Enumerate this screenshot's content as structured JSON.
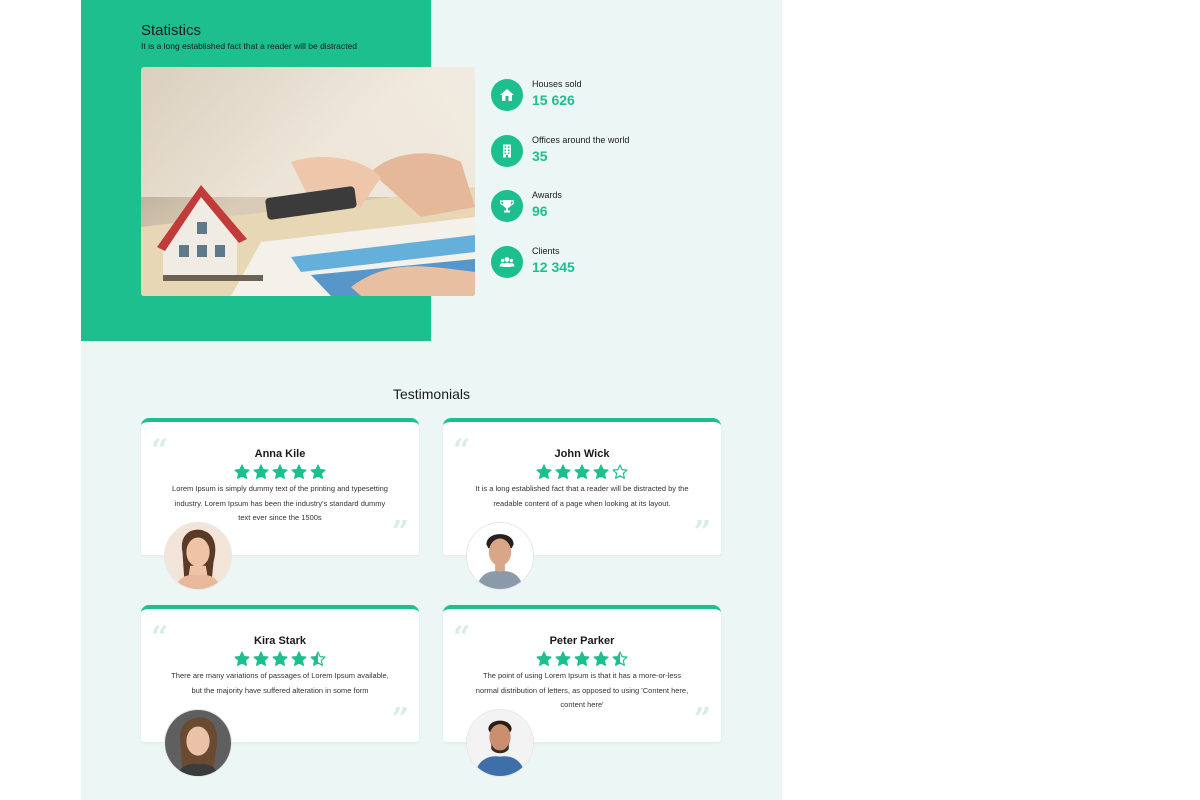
{
  "statistics": {
    "title": "Statistics",
    "subtitle": "It is a long established fact that a reader will be distracted",
    "items": [
      {
        "label": "Houses sold",
        "value": "15 626",
        "icon": "house-icon"
      },
      {
        "label": "Offices around the world",
        "value": "35",
        "icon": "building-icon"
      },
      {
        "label": "Awards",
        "value": "96",
        "icon": "trophy-icon"
      },
      {
        "label": "Clients",
        "value": "12 345",
        "icon": "users-icon"
      }
    ]
  },
  "testimonials": {
    "title": "Testimonials",
    "cards": [
      {
        "name": "Anna Kile",
        "rating": 5,
        "text": "Lorem Ipsum is simply dummy text of the printing and typesetting industry. Lorem Ipsum has been the industry's standard dummy text ever since the 1500s"
      },
      {
        "name": "John Wick",
        "rating": 4,
        "text": "It is a long established fact that a reader will be distracted by the readable content of a page when looking at its layout."
      },
      {
        "name": "Kira Stark",
        "rating": 4.5,
        "text": "There are many variations of passages of Lorem Ipsum available, but the majority have suffered alteration in some form"
      },
      {
        "name": "Peter Parker",
        "rating": 4.5,
        "text": "The point of using Lorem Ipsum is that it has a more-or-less normal distribution of letters, as opposed to using 'Content here, content here'"
      }
    ]
  },
  "colors": {
    "accent": "#1dbf8f",
    "background": "#ecf7f5"
  }
}
